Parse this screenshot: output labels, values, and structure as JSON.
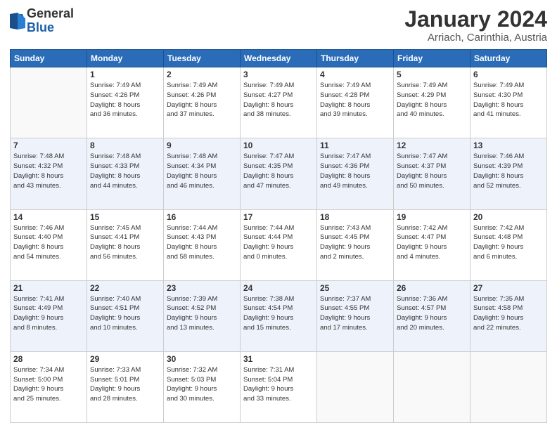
{
  "header": {
    "logo_line1": "General",
    "logo_line2": "Blue",
    "title": "January 2024",
    "subtitle": "Arriach, Carinthia, Austria"
  },
  "weekdays": [
    "Sunday",
    "Monday",
    "Tuesday",
    "Wednesday",
    "Thursday",
    "Friday",
    "Saturday"
  ],
  "rows": [
    [
      {
        "num": "",
        "sunrise": "",
        "sunset": "",
        "daylight": ""
      },
      {
        "num": "1",
        "sunrise": "Sunrise: 7:49 AM",
        "sunset": "Sunset: 4:26 PM",
        "daylight": "Daylight: 8 hours and 36 minutes."
      },
      {
        "num": "2",
        "sunrise": "Sunrise: 7:49 AM",
        "sunset": "Sunset: 4:26 PM",
        "daylight": "Daylight: 8 hours and 37 minutes."
      },
      {
        "num": "3",
        "sunrise": "Sunrise: 7:49 AM",
        "sunset": "Sunset: 4:27 PM",
        "daylight": "Daylight: 8 hours and 38 minutes."
      },
      {
        "num": "4",
        "sunrise": "Sunrise: 7:49 AM",
        "sunset": "Sunset: 4:28 PM",
        "daylight": "Daylight: 8 hours and 39 minutes."
      },
      {
        "num": "5",
        "sunrise": "Sunrise: 7:49 AM",
        "sunset": "Sunset: 4:29 PM",
        "daylight": "Daylight: 8 hours and 40 minutes."
      },
      {
        "num": "6",
        "sunrise": "Sunrise: 7:49 AM",
        "sunset": "Sunset: 4:30 PM",
        "daylight": "Daylight: 8 hours and 41 minutes."
      }
    ],
    [
      {
        "num": "7",
        "sunrise": "Sunrise: 7:48 AM",
        "sunset": "Sunset: 4:32 PM",
        "daylight": "Daylight: 8 hours and 43 minutes."
      },
      {
        "num": "8",
        "sunrise": "Sunrise: 7:48 AM",
        "sunset": "Sunset: 4:33 PM",
        "daylight": "Daylight: 8 hours and 44 minutes."
      },
      {
        "num": "9",
        "sunrise": "Sunrise: 7:48 AM",
        "sunset": "Sunset: 4:34 PM",
        "daylight": "Daylight: 8 hours and 46 minutes."
      },
      {
        "num": "10",
        "sunrise": "Sunrise: 7:47 AM",
        "sunset": "Sunset: 4:35 PM",
        "daylight": "Daylight: 8 hours and 47 minutes."
      },
      {
        "num": "11",
        "sunrise": "Sunrise: 7:47 AM",
        "sunset": "Sunset: 4:36 PM",
        "daylight": "Daylight: 8 hours and 49 minutes."
      },
      {
        "num": "12",
        "sunrise": "Sunrise: 7:47 AM",
        "sunset": "Sunset: 4:37 PM",
        "daylight": "Daylight: 8 hours and 50 minutes."
      },
      {
        "num": "13",
        "sunrise": "Sunrise: 7:46 AM",
        "sunset": "Sunset: 4:39 PM",
        "daylight": "Daylight: 8 hours and 52 minutes."
      }
    ],
    [
      {
        "num": "14",
        "sunrise": "Sunrise: 7:46 AM",
        "sunset": "Sunset: 4:40 PM",
        "daylight": "Daylight: 8 hours and 54 minutes."
      },
      {
        "num": "15",
        "sunrise": "Sunrise: 7:45 AM",
        "sunset": "Sunset: 4:41 PM",
        "daylight": "Daylight: 8 hours and 56 minutes."
      },
      {
        "num": "16",
        "sunrise": "Sunrise: 7:44 AM",
        "sunset": "Sunset: 4:43 PM",
        "daylight": "Daylight: 8 hours and 58 minutes."
      },
      {
        "num": "17",
        "sunrise": "Sunrise: 7:44 AM",
        "sunset": "Sunset: 4:44 PM",
        "daylight": "Daylight: 9 hours and 0 minutes."
      },
      {
        "num": "18",
        "sunrise": "Sunrise: 7:43 AM",
        "sunset": "Sunset: 4:45 PM",
        "daylight": "Daylight: 9 hours and 2 minutes."
      },
      {
        "num": "19",
        "sunrise": "Sunrise: 7:42 AM",
        "sunset": "Sunset: 4:47 PM",
        "daylight": "Daylight: 9 hours and 4 minutes."
      },
      {
        "num": "20",
        "sunrise": "Sunrise: 7:42 AM",
        "sunset": "Sunset: 4:48 PM",
        "daylight": "Daylight: 9 hours and 6 minutes."
      }
    ],
    [
      {
        "num": "21",
        "sunrise": "Sunrise: 7:41 AM",
        "sunset": "Sunset: 4:49 PM",
        "daylight": "Daylight: 9 hours and 8 minutes."
      },
      {
        "num": "22",
        "sunrise": "Sunrise: 7:40 AM",
        "sunset": "Sunset: 4:51 PM",
        "daylight": "Daylight: 9 hours and 10 minutes."
      },
      {
        "num": "23",
        "sunrise": "Sunrise: 7:39 AM",
        "sunset": "Sunset: 4:52 PM",
        "daylight": "Daylight: 9 hours and 13 minutes."
      },
      {
        "num": "24",
        "sunrise": "Sunrise: 7:38 AM",
        "sunset": "Sunset: 4:54 PM",
        "daylight": "Daylight: 9 hours and 15 minutes."
      },
      {
        "num": "25",
        "sunrise": "Sunrise: 7:37 AM",
        "sunset": "Sunset: 4:55 PM",
        "daylight": "Daylight: 9 hours and 17 minutes."
      },
      {
        "num": "26",
        "sunrise": "Sunrise: 7:36 AM",
        "sunset": "Sunset: 4:57 PM",
        "daylight": "Daylight: 9 hours and 20 minutes."
      },
      {
        "num": "27",
        "sunrise": "Sunrise: 7:35 AM",
        "sunset": "Sunset: 4:58 PM",
        "daylight": "Daylight: 9 hours and 22 minutes."
      }
    ],
    [
      {
        "num": "28",
        "sunrise": "Sunrise: 7:34 AM",
        "sunset": "Sunset: 5:00 PM",
        "daylight": "Daylight: 9 hours and 25 minutes."
      },
      {
        "num": "29",
        "sunrise": "Sunrise: 7:33 AM",
        "sunset": "Sunset: 5:01 PM",
        "daylight": "Daylight: 9 hours and 28 minutes."
      },
      {
        "num": "30",
        "sunrise": "Sunrise: 7:32 AM",
        "sunset": "Sunset: 5:03 PM",
        "daylight": "Daylight: 9 hours and 30 minutes."
      },
      {
        "num": "31",
        "sunrise": "Sunrise: 7:31 AM",
        "sunset": "Sunset: 5:04 PM",
        "daylight": "Daylight: 9 hours and 33 minutes."
      },
      {
        "num": "",
        "sunrise": "",
        "sunset": "",
        "daylight": ""
      },
      {
        "num": "",
        "sunrise": "",
        "sunset": "",
        "daylight": ""
      },
      {
        "num": "",
        "sunrise": "",
        "sunset": "",
        "daylight": ""
      }
    ]
  ]
}
